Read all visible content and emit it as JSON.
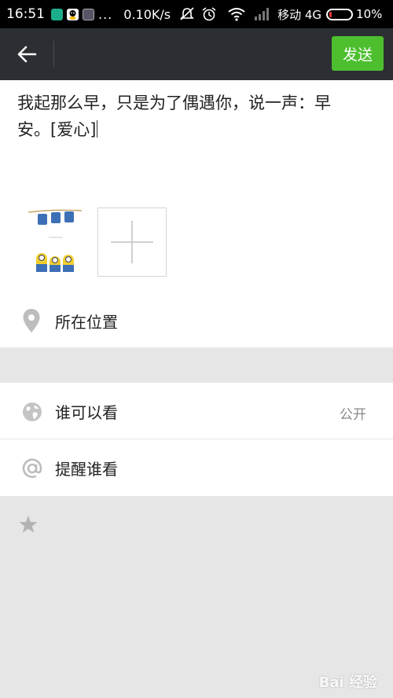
{
  "status_bar": {
    "time": "16:51",
    "dots": "...",
    "speed": "0.10K/s",
    "carrier": "移动 4G",
    "battery": "10%",
    "battery_level": 0.1
  },
  "header": {
    "send_label": "发送"
  },
  "compose": {
    "text_line1": "我起那么早，只是为了偶遇你，说一声：早",
    "text_line2": "安。[爱心]"
  },
  "location": {
    "label": "所在位置"
  },
  "visibility": {
    "label": "谁可以看",
    "value": "公开"
  },
  "mention": {
    "label": "提醒谁看"
  },
  "watermark": "Bai 经验",
  "colors": {
    "send_button": "#4dbf2f",
    "header_bg": "#2b2f33",
    "page_bg": "#e6e6e6"
  }
}
